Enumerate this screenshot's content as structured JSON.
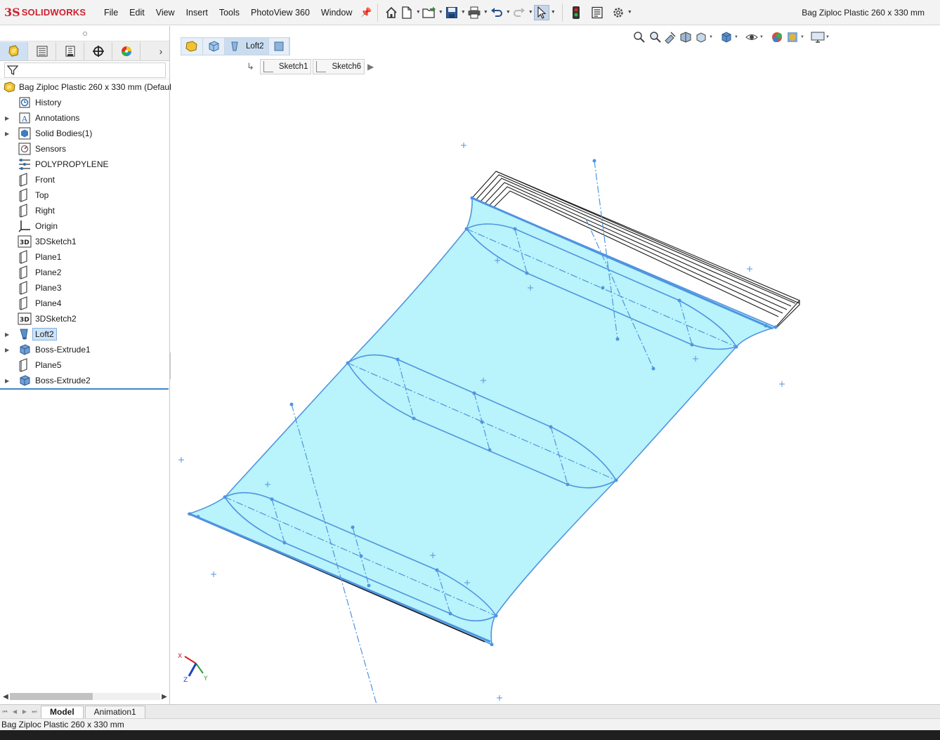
{
  "app": {
    "logo_ds": "3S",
    "logo_text": "SOLIDWORKS",
    "window_title": "Bag Ziploc Plastic 260 x 330 mm"
  },
  "menu": [
    "File",
    "Edit",
    "View",
    "Insert",
    "Tools",
    "PhotoView 360",
    "Window"
  ],
  "toolbar": {
    "icons": [
      "home-icon",
      "new-document-icon",
      "open-icon",
      "save-icon",
      "print-icon",
      "undo-icon",
      "redo-icon",
      "select-icon",
      "rebuild-icon",
      "file-properties-icon",
      "options-icon"
    ]
  },
  "feature_tree": {
    "root_label": "Bag Ziploc Plastic 260 x 330 mm  (Defaul",
    "items": [
      {
        "label": "History",
        "icon": "history-icon",
        "expandable": false
      },
      {
        "label": "Annotations",
        "icon": "annotations-icon",
        "expandable": true
      },
      {
        "label": "Solid Bodies(1)",
        "icon": "solid-bodies-icon",
        "expandable": true
      },
      {
        "label": "Sensors",
        "icon": "sensors-icon",
        "expandable": false
      },
      {
        "label": "POLYPROPYLENE",
        "icon": "material-icon",
        "expandable": false
      },
      {
        "label": "Front",
        "icon": "plane-icon",
        "expandable": false
      },
      {
        "label": "Top",
        "icon": "plane-icon",
        "expandable": false
      },
      {
        "label": "Right",
        "icon": "plane-icon",
        "expandable": false
      },
      {
        "label": "Origin",
        "icon": "origin-icon",
        "expandable": false
      },
      {
        "label": "3DSketch1",
        "icon": "3dsketch-icon",
        "expandable": false
      },
      {
        "label": "Plane1",
        "icon": "plane-icon",
        "expandable": false
      },
      {
        "label": "Plane2",
        "icon": "plane-icon",
        "expandable": false
      },
      {
        "label": "Plane3",
        "icon": "plane-icon",
        "expandable": false
      },
      {
        "label": "Plane4",
        "icon": "plane-icon",
        "expandable": false
      },
      {
        "label": "3DSketch2",
        "icon": "3dsketch-icon",
        "expandable": false
      },
      {
        "label": "Loft2",
        "icon": "loft-icon",
        "expandable": true,
        "selected": true
      },
      {
        "label": "Boss-Extrude1",
        "icon": "extrude-icon",
        "expandable": true
      },
      {
        "label": "Plane5",
        "icon": "plane-icon",
        "expandable": false
      },
      {
        "label": "Boss-Extrude2",
        "icon": "extrude-icon",
        "expandable": true
      }
    ]
  },
  "breadcrumb": {
    "feature": "Loft2",
    "sketches": [
      "Sketch1",
      "Sketch6"
    ]
  },
  "bottom_tabs": [
    "Model",
    "Animation1"
  ],
  "status_text": "Bag Ziploc Plastic 260 x 330 mm",
  "triad": {
    "x": "X",
    "y": "Y",
    "z": "Z"
  },
  "colors": {
    "accent": "#3d86c6",
    "loft_fill": "#b9f3fb",
    "loft_edge": "#4f94e0",
    "logo_red": "#d0202e"
  }
}
